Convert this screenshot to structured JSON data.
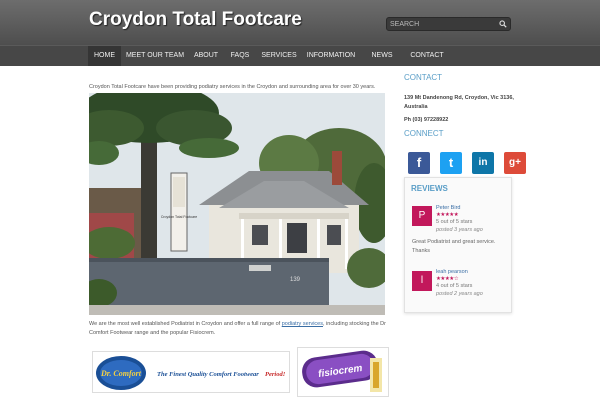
{
  "header": {
    "site_title": "Croydon Total Footcare",
    "search_placeholder": "SEARCH"
  },
  "nav": {
    "items": [
      {
        "label": "HOME",
        "active": true
      },
      {
        "label": "MEET OUR TEAM"
      },
      {
        "label": "ABOUT"
      },
      {
        "label": "FAQS"
      },
      {
        "label": "SERVICES"
      },
      {
        "label": "INFORMATION"
      },
      {
        "label": "NEWS"
      },
      {
        "label": "CONTACT"
      }
    ]
  },
  "main": {
    "intro": "Croydon Total Footcare have been providing podiatry services in the Croydon and surrounding area for over 30 years.",
    "body_before_link": "We are the most well established Podiatrist in Croydon and offer a full range of ",
    "body_link": "podiatry services",
    "body_after_link": ", including stocking the Dr Comfort Footwear range and the popular Fisiocrem.",
    "drcomfort_logo_text": "Dr. Comfort",
    "drcomfort_tagline": "The Finest Quality Comfort Footwear",
    "drcomfort_tagline_end": "Period!",
    "fisiocrem_logo_text": "fisiocrem",
    "sign_text": "139",
    "sign_board_text": "Croydon Total Footcare"
  },
  "sidebar": {
    "contact_heading": "CONTACT",
    "address": "139 Mt Dandenong Rd, Croydon, Vic 3136, Australia",
    "phone": "Ph (03) 97228922",
    "connect_heading": "CONNECT",
    "social": [
      {
        "name": "facebook",
        "glyph": "f",
        "color": "#3b5998"
      },
      {
        "name": "twitter",
        "glyph": "t",
        "color": "#1da1f2"
      },
      {
        "name": "linkedin",
        "glyph": "in",
        "color": "#0e76a8"
      },
      {
        "name": "google-plus",
        "glyph": "g+",
        "color": "#dd4b39"
      }
    ],
    "reviews": {
      "title": "REVIEWS",
      "items": [
        {
          "initial": "P",
          "name": "Peter Bird",
          "stars": "★★★★★",
          "rating": 5,
          "rating_text": "5 out of 5 stars",
          "ago": "posted 3 years ago",
          "text": "Great Podiatrist and great service. Thanks"
        },
        {
          "initial": "l",
          "name": "leah pearson",
          "stars": "★★★★☆",
          "rating": 4,
          "rating_text": "4 out of 5 stars",
          "ago": "posted 2 years ago",
          "text": ""
        }
      ]
    }
  },
  "colors": {
    "header_bg": "#5e5e5e",
    "nav_bg": "#474747",
    "accent": "#5a9ec7",
    "review_avatar": "#c2185b",
    "link": "#3a6ea5"
  }
}
